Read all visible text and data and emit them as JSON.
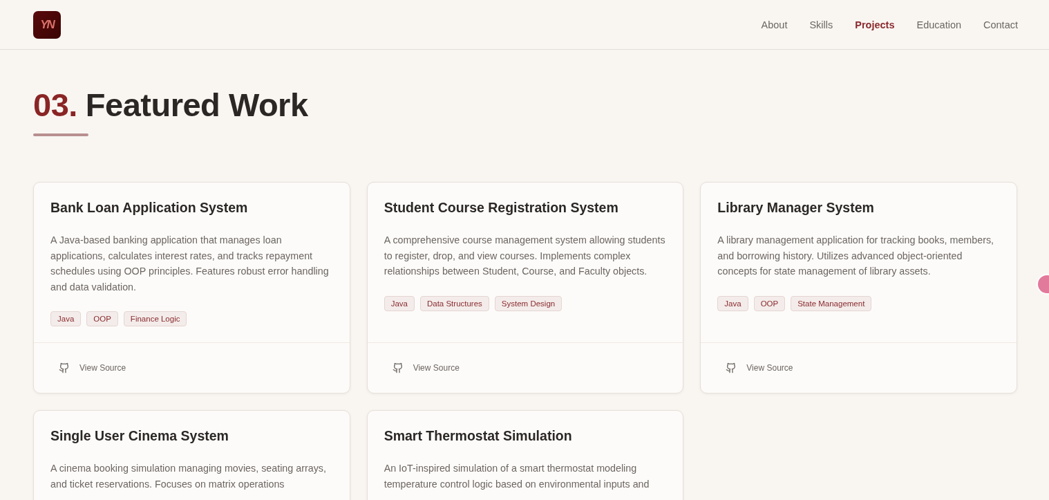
{
  "header": {
    "logo": "YN",
    "nav": [
      {
        "label": "About",
        "selected": false
      },
      {
        "label": "Skills",
        "selected": false
      },
      {
        "label": "Projects",
        "selected": true
      },
      {
        "label": "Education",
        "selected": false
      },
      {
        "label": "Contact",
        "selected": false
      }
    ]
  },
  "section": {
    "number": "03.",
    "title": "Featured Work"
  },
  "projects": [
    {
      "title": "Bank Loan Application System",
      "description": "A Java-based banking application that manages loan applications, calculates interest rates, and tracks repayment schedules using OOP principles. Features robust error handling and data validation.",
      "tags": [
        "Java",
        "OOP",
        "Finance Logic"
      ],
      "link": "View Source"
    },
    {
      "title": "Student Course Registration System",
      "description": "A comprehensive course management system allowing students to register, drop, and view courses. Implements complex relationships between Student, Course, and Faculty objects.",
      "tags": [
        "Java",
        "Data Structures",
        "System Design"
      ],
      "link": "View Source"
    },
    {
      "title": "Library Manager System",
      "description": "A library management application for tracking books, members, and borrowing history. Utilizes advanced object-oriented concepts for state management of library assets.",
      "tags": [
        "Java",
        "OOP",
        "State Management"
      ],
      "link": "View Source"
    },
    {
      "title": "Single User Cinema System",
      "description": "A cinema booking simulation managing movies, seating arrays, and ticket reservations. Focuses on matrix operations"
    },
    {
      "title": "Smart Thermostat Simulation",
      "description": "An IoT-inspired simulation of a smart thermostat modeling temperature control logic based on environmental inputs and"
    }
  ]
}
